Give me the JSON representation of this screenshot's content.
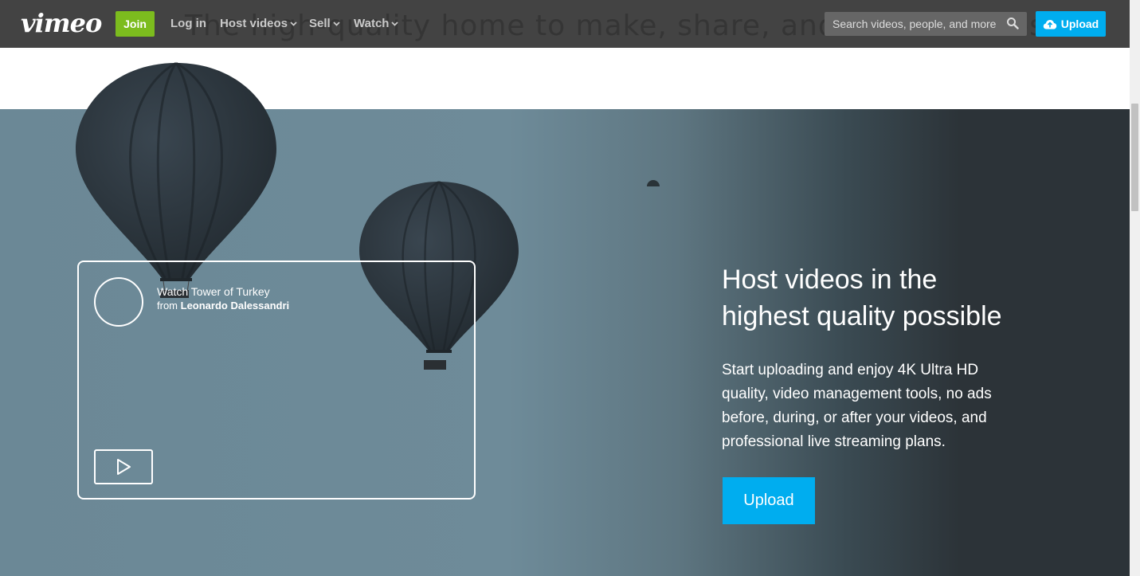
{
  "header": {
    "logo": "vimeo",
    "join_label": "Join",
    "nav": {
      "login": "Log in",
      "host_videos": "Host videos",
      "sell": "Sell",
      "watch": "Watch"
    },
    "search_placeholder": "Search videos, people, and more",
    "upload_label": "Upload",
    "ghost_tagline": "The high-quality home to make, share, and watch videos"
  },
  "video_card": {
    "title": "Watch Tower of Turkey",
    "from_prefix": "from",
    "author": "Leonardo Dalessandri"
  },
  "hero": {
    "headline_line1": "Host videos in the",
    "headline_line2": "highest quality possible",
    "body": "Start uploading and enjoy 4K Ultra HD quality, video management tools, no ads before, during, or after your videos, and professional live streaming plans.",
    "cta_label": "Upload"
  },
  "colors": {
    "header_bg": "#434343",
    "join_green": "#7cbc1e",
    "upload_blue": "#00adef"
  },
  "icons": {
    "search": "search-icon",
    "upload_cloud": "cloud-upload-icon",
    "play": "play-icon",
    "chevron": "chevron-down-icon"
  }
}
